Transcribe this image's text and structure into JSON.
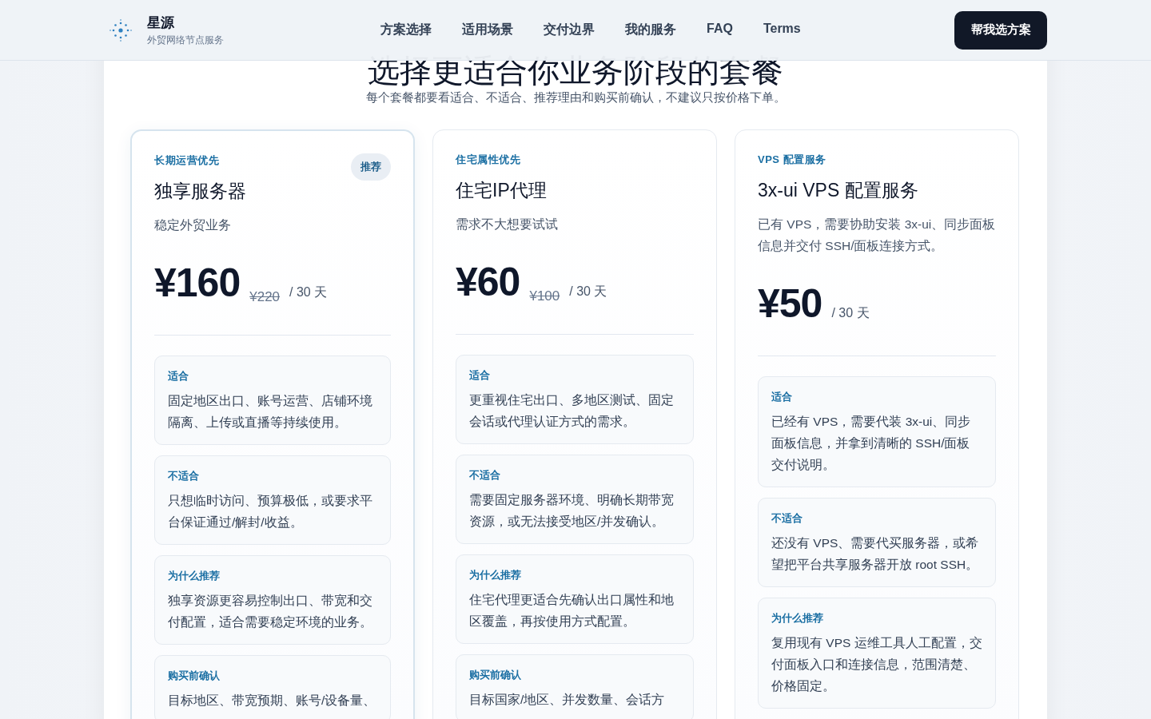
{
  "header": {
    "brand": "星源",
    "tagline": "外贸网络节点服务",
    "nav": [
      "方案选择",
      "适用场景",
      "交付边界",
      "我的服务",
      "FAQ",
      "Terms"
    ],
    "cta": "帮我选方案"
  },
  "intro": {
    "title": "选择更适合你业务阶段的套餐",
    "subtitle": "每个套餐都要看适合、不适合、推荐理由和购买前确认，不建议只按价格下单。"
  },
  "plans": [
    {
      "eyebrow": "长期运营优先",
      "name": "独享服务器",
      "description": "稳定外贸业务",
      "recommended": true,
      "badge": "推荐",
      "price": "¥160",
      "old_price": "¥220",
      "period": "/ 30 天",
      "sections": [
        {
          "label": "适合",
          "text": "固定地区出口、账号运营、店铺环境隔离、上传或直播等持续使用。"
        },
        {
          "label": "不适合",
          "text": "只想临时访问、预算极低，或要求平台保证通过/解封/收益。"
        },
        {
          "label": "为什么推荐",
          "text": "独享资源更容易控制出口、带宽和交付配置，适合需要稳定环境的业务。"
        },
        {
          "label": "购买前确认",
          "text": "目标地区、带宽预期、账号/设备量、"
        }
      ]
    },
    {
      "eyebrow": "住宅属性优先",
      "name": "住宅IP代理",
      "description": "需求不大想要试试",
      "recommended": false,
      "price": "¥60",
      "old_price": "¥100",
      "period": "/ 30 天",
      "sections": [
        {
          "label": "适合",
          "text": "更重视住宅出口、多地区测试、固定会话或代理认证方式的需求。"
        },
        {
          "label": "不适合",
          "text": "需要固定服务器环境、明确长期带宽资源，或无法接受地区/并发确认。"
        },
        {
          "label": "为什么推荐",
          "text": "住宅代理更适合先确认出口属性和地区覆盖，再按使用方式配置。"
        },
        {
          "label": "购买前确认",
          "text": "目标国家/地区、并发数量、会话方"
        }
      ]
    },
    {
      "eyebrow": "VPS 配置服务",
      "name": "3x-ui VPS 配置服务",
      "description": "已有 VPS，需要协助安装 3x-ui、同步面板信息并交付 SSH/面板连接方式。",
      "recommended": false,
      "price": "¥50",
      "period": "/ 30 天",
      "sections": [
        {
          "label": "适合",
          "text": "已经有 VPS，需要代装 3x-ui、同步面板信息，并拿到清晰的 SSH/面板交付说明。"
        },
        {
          "label": "不适合",
          "text": "还没有 VPS、需要代买服务器，或希望把平台共享服务器开放 root SSH。"
        },
        {
          "label": "为什么推荐",
          "text": "复用现有 VPS 运维工具人工配置，交付面板入口和连接信息，范围清楚、价格固定。"
        }
      ]
    }
  ]
}
